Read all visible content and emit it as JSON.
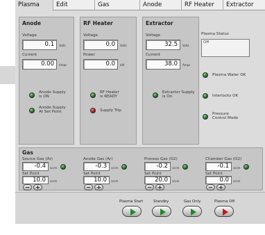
{
  "tabs": [
    "Plasma",
    "Edit",
    "Gas",
    "Anode",
    "RF Heater",
    "Extractor"
  ],
  "anode": {
    "title": "Anode",
    "voltage_label": "Voltage",
    "voltage": "0.1",
    "voltage_unit": "Volts",
    "current_label": "Current",
    "current": "0.00",
    "current_unit": "Amps",
    "status1": [
      "Anode Supply",
      "is ON"
    ],
    "status2": [
      "Anode Supply",
      "At Set Point"
    ]
  },
  "rf": {
    "title": "RF Heater",
    "voltage_label": "Voltage",
    "voltage": "0.0",
    "voltage_unit": "Volts",
    "power_label": "Power",
    "power": "0.0",
    "power_unit": "kW",
    "status1": [
      "RF Heater",
      "is READY"
    ],
    "status2": [
      "Supply Trip"
    ]
  },
  "extractor": {
    "title": "Extractor",
    "voltage_label": "Voltage",
    "voltage": "32.5",
    "voltage_unit": "Volts",
    "current_label": "Current",
    "current": "38.0",
    "current_unit": "Amps",
    "status1": [
      "Extractor Supply",
      "is On"
    ]
  },
  "plasma_status": {
    "label": "Plasma Status",
    "value": "Off",
    "items": [
      [
        "Plasma Water OK"
      ],
      [
        "Interlocks OK"
      ],
      [
        "Pressure",
        "Control Mode"
      ]
    ]
  },
  "gas": {
    "title": "Gas",
    "sources": [
      {
        "label": "Source Gas (Ar)",
        "value": "-0.4",
        "unit": "sccm",
        "sp_label": "Set Point",
        "sp": "10.0",
        "sp_unit": "sccm"
      },
      {
        "label": "Anode Gas (Ar)",
        "value": "-0.3",
        "unit": "sccm",
        "sp_label": "Set Point",
        "sp": "10.0",
        "sp_unit": "sccm"
      },
      {
        "label": "Process Gas (O2)",
        "value": "-0.2",
        "unit": "sccm",
        "sp_label": "Set Point",
        "sp": "20.0",
        "sp_unit": "sccm"
      },
      {
        "label": "Chamber Gas (O2)",
        "value": "-0.1",
        "unit": "sccm",
        "sp_label": "Set Point",
        "sp": "0.0",
        "sp_unit": "sccm"
      }
    ],
    "minus": "−",
    "plus": "+"
  },
  "buttons": {
    "plasma_start": "Plasma Start",
    "standby": "Standby",
    "gas_only": "Gas Only",
    "plasma_off": "Plasma Off"
  },
  "colors": {
    "led_green": "#1f6a22",
    "led_red": "#aa1111",
    "start_green": "#1c8a2c",
    "off_red": "#c01818"
  }
}
